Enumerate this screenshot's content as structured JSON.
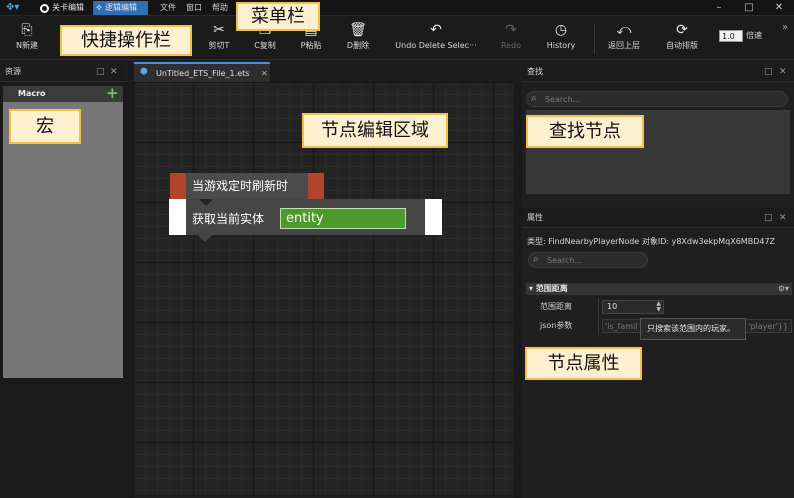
{
  "menubar": {
    "mode_level": "关卡编辑",
    "mode_logic": "逻辑编辑",
    "menu_file": "文件",
    "menu_window": "窗口",
    "menu_help": "帮助",
    "minimize": "–",
    "maximize": "□",
    "close": "✕"
  },
  "toolbar": {
    "new": "N新建",
    "cut": "剪切T",
    "copy": "C复制",
    "paste": "P粘贴",
    "delete": "D删除",
    "undo": "Undo Delete Selec···",
    "redo": "Redo",
    "history": "History",
    "back": "返回上层",
    "auto_layout": "自动排版",
    "zoom_value": "1.0",
    "zoom_unit": "倍速",
    "more": "»"
  },
  "left_panel": {
    "title": "资源",
    "macro_title": "Macro",
    "add": "+"
  },
  "editor": {
    "tab_label": "UnTitled_ETS_File_1.ets",
    "tab_close": "✕",
    "event_node_label": "当游戏定时刷新时",
    "action_node_label": "获取当前实体",
    "entity_value": "entity"
  },
  "find_panel": {
    "title": "查找",
    "search_placeholder": "Search..."
  },
  "props_panel": {
    "title": "属性",
    "type_line": "类型: FindNearbyPlayerNode  对象ID: y8Xdw3ekpMqX6MBD47Z",
    "search_placeholder": "Search...",
    "section_title": "范围距离",
    "range_label": "范围距离",
    "range_value": "10",
    "json_label": "json参数",
    "json_left": "'is_famil",
    "json_right": "'player'}}",
    "tooltip": "只搜索该范围内的玩家。"
  },
  "annotations": {
    "menubar": "菜单栏",
    "toolbar": "快捷操作栏",
    "macro": "宏",
    "node_area": "节点编辑区域",
    "find_node": "查找节点",
    "node_props": "节点属性"
  },
  "colors": {
    "accent_blue": "#2f6fb5",
    "event_cap": "#b0452c",
    "entity_green": "#4c9a2c",
    "annotation_bg": "#fdf0d0",
    "annotation_border": "#f2c14b",
    "add_green": "#5fd14a"
  }
}
